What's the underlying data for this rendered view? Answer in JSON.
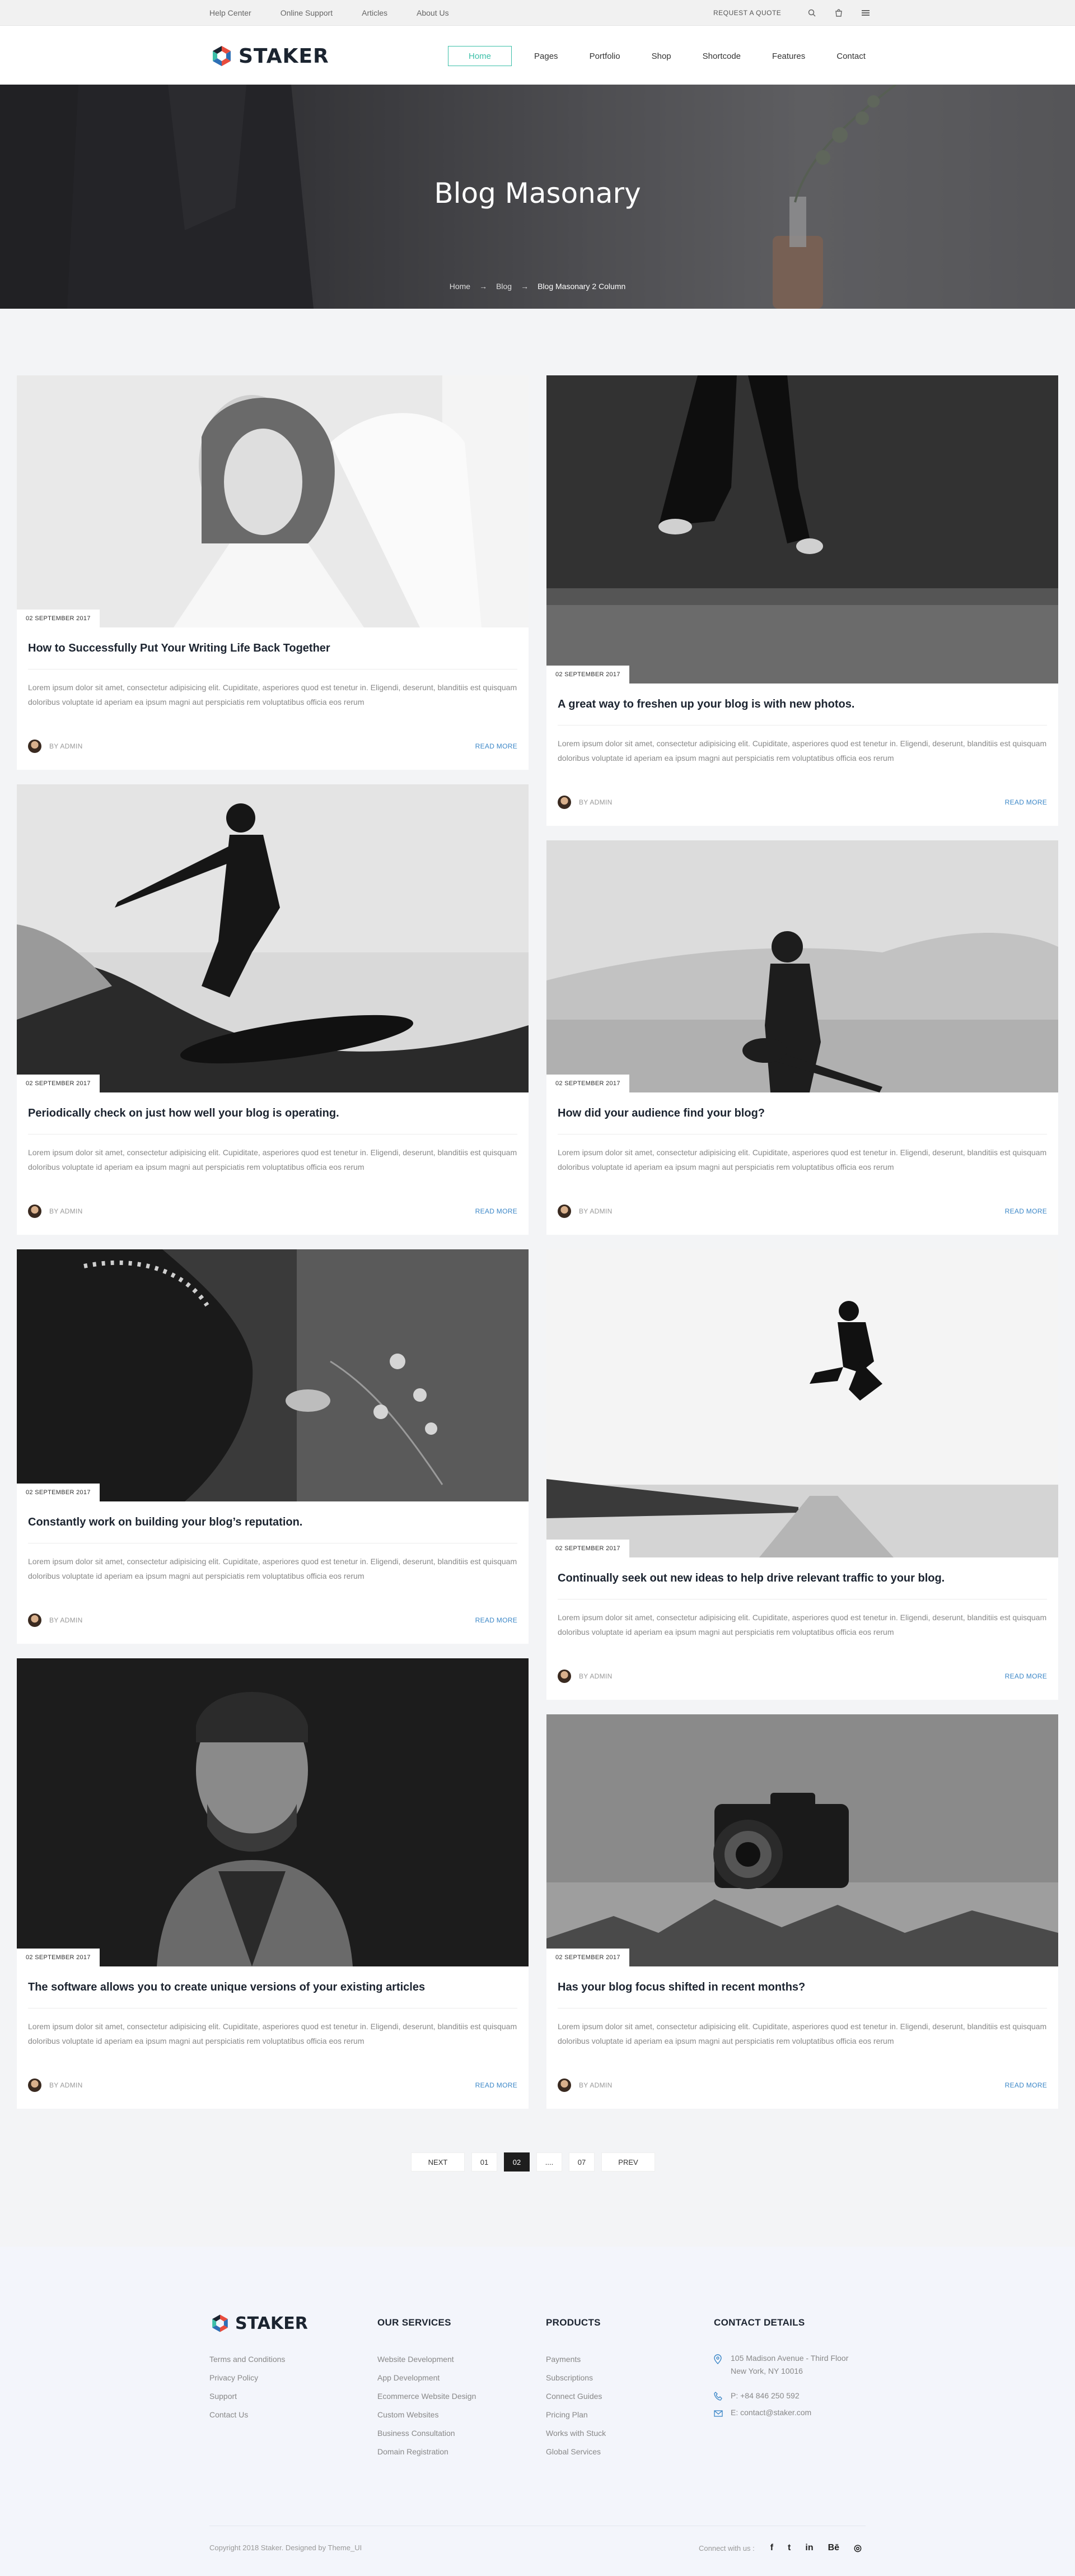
{
  "topbar": {
    "links": [
      "Help Center",
      "Online Support",
      "Articles",
      "About Us"
    ],
    "quote": "REQUEST A QUOTE",
    "icons": [
      "search-icon",
      "cart-icon",
      "menu-icon"
    ]
  },
  "header": {
    "logo": "STAKER",
    "nav": [
      "Home",
      "Pages",
      "Portfolio",
      "Shop",
      "Shortcode",
      "Features",
      "Contact"
    ]
  },
  "hero": {
    "title": "Blog Masonary",
    "breadcrumb": [
      "Home",
      "Blog",
      "Blog Masonary 2 Column"
    ],
    "separator": "→"
  },
  "posts": [
    {
      "date": "02 SEPTEMBER 2017",
      "title": "How to Successfully Put Your Writing Life Back Together",
      "excerpt": "Lorem ipsum dolor sit amet, consectetur adipisicing elit. Cupiditate, asperiores quod est tenetur in. Eligendi, deserunt, blanditiis est quisquam doloribus voluptate id aperiam ea ipsum magni aut perspiciatis rem voluptatibus officia eos rerum",
      "author": "BY ADMIN",
      "more": "READ MORE",
      "image": "woman-portrait"
    },
    {
      "date": "02 SEPTEMBER 2017",
      "title": "A great way to freshen up your blog is with new photos.",
      "excerpt": "Lorem ipsum dolor sit amet, consectetur adipisicing elit. Cupiditate, asperiores quod est tenetur in. Eligendi, deserunt, blanditiis est quisquam doloribus voluptate id aperiam ea ipsum magni aut perspiciatis rem voluptatibus officia eos rerum",
      "author": "BY ADMIN",
      "more": "READ MORE",
      "image": "jumping-legs"
    },
    {
      "date": "02 SEPTEMBER 2017",
      "title": "Periodically check on just how well your blog is operating.",
      "excerpt": "Lorem ipsum dolor sit amet, consectetur adipisicing elit. Cupiditate, asperiores quod est tenetur in. Eligendi, deserunt, blanditiis est quisquam doloribus voluptate id aperiam ea ipsum magni aut perspiciatis rem voluptatibus officia eos rerum",
      "author": "BY ADMIN",
      "more": "READ MORE",
      "image": "surfer"
    },
    {
      "date": "02 SEPTEMBER 2017",
      "title": "How did your audience find your blog?",
      "excerpt": "Lorem ipsum dolor sit amet, consectetur adipisicing elit. Cupiditate, asperiores quod est tenetur in. Eligendi, deserunt, blanditiis est quisquam doloribus voluptate id aperiam ea ipsum magni aut perspiciatis rem voluptatibus officia eos rerum",
      "author": "BY ADMIN",
      "more": "READ MORE",
      "image": "guitarist-desert"
    },
    {
      "date": "02 SEPTEMBER 2017",
      "title": "Constantly work on building your blog’s reputation.",
      "excerpt": "Lorem ipsum dolor sit amet, consectetur adipisicing elit. Cupiditate, asperiores quod est tenetur in. Eligendi, deserunt, blanditiis est quisquam doloribus voluptate id aperiam ea ipsum magni aut perspiciatis rem voluptatibus officia eos rerum",
      "author": "BY ADMIN",
      "more": "READ MORE",
      "image": "girl-flowers"
    },
    {
      "date": "02 SEPTEMBER 2017",
      "title": "Continually seek out new ideas to help drive relevant traffic to your blog.",
      "excerpt": "Lorem ipsum dolor sit amet, consectetur adipisicing elit. Cupiditate, asperiores quod est tenetur in. Eligendi, deserunt, blanditiis est quisquam doloribus voluptate id aperiam ea ipsum magni aut perspiciatis rem voluptatibus officia eos rerum",
      "author": "BY ADMIN",
      "more": "READ MORE",
      "image": "man-jumping-road"
    },
    {
      "date": "02 SEPTEMBER 2017",
      "title": "The software allows you to create unique versions of your existing articles",
      "excerpt": "Lorem ipsum dolor sit amet, consectetur adipisicing elit. Cupiditate, asperiores quod est tenetur in. Eligendi, deserunt, blanditiis est quisquam doloribus voluptate id aperiam ea ipsum magni aut perspiciatis rem voluptatibus officia eos rerum",
      "author": "BY ADMIN",
      "more": "READ MORE",
      "image": "man-portrait"
    },
    {
      "date": "02 SEPTEMBER 2017",
      "title": "Has your blog focus shifted in recent months?",
      "excerpt": "Lorem ipsum dolor sit amet, consectetur adipisicing elit. Cupiditate, asperiores quod est tenetur in. Eligendi, deserunt, blanditiis est quisquam doloribus voluptate id aperiam ea ipsum magni aut perspiciatis rem voluptatibus officia eos rerum",
      "author": "BY ADMIN",
      "more": "READ MORE",
      "image": "floating-camera"
    }
  ],
  "pagination": [
    "NEXT",
    "01",
    "02",
    "....",
    "07",
    "PREV"
  ],
  "pagination_current": "02",
  "footer": {
    "logo": "STAKER",
    "about_links": [
      "Terms and Conditions",
      "Privacy Policy",
      "Support",
      "Contact Us"
    ],
    "services_title": "OUR SERVICES",
    "services": [
      "Website Development",
      "App Development",
      "Ecommerce Website Design",
      "Custom Websites",
      "Business Consultation",
      "Domain Registration"
    ],
    "products_title": "PRODUCTS",
    "products": [
      "Payments",
      "Subscriptions",
      "Connect Guides",
      "Pricing Plan",
      "Works with Stuck",
      "Global Services"
    ],
    "contact_title": "CONTACT DETAILS",
    "address_line1": "105 Madison Avenue - Third Floor",
    "address_line2": "New York, NY 10016",
    "phone": "P:  +84 846 250 592",
    "email": "E:  contact@staker.com",
    "copyright": "Copyright 2018 Staker. Designed by Theme_UI",
    "connect_label": "Connect with us :",
    "social": [
      "f",
      "t",
      "in",
      "Bē",
      "◎"
    ]
  },
  "colors": {
    "accent": "#3bbfa8",
    "link": "#3a86c7",
    "dark": "#1e1e1e"
  }
}
